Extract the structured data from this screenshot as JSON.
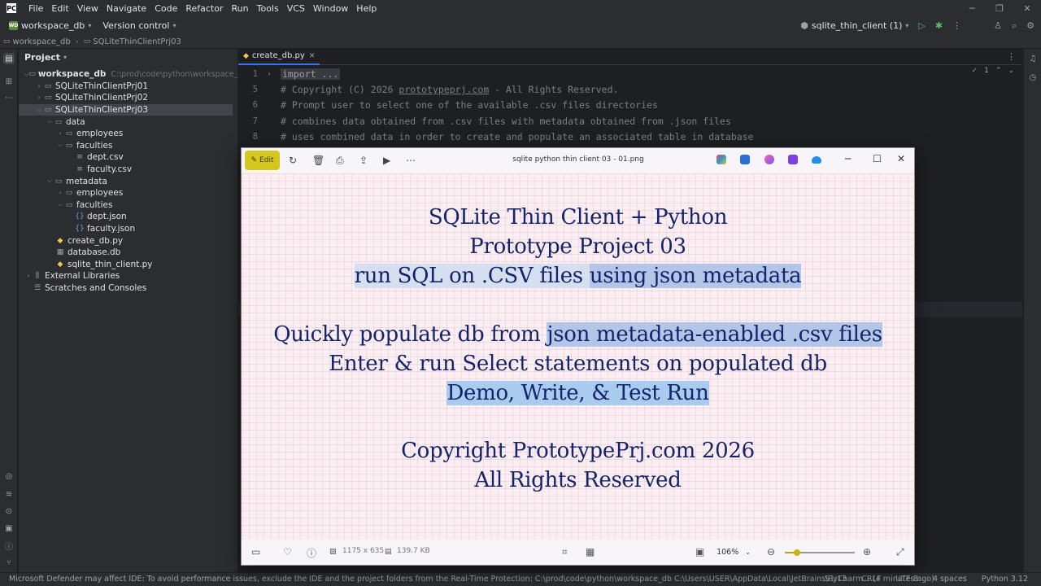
{
  "menu": [
    "File",
    "Edit",
    "View",
    "Navigate",
    "Code",
    "Refactor",
    "Run",
    "Tools",
    "VCS",
    "Window",
    "Help"
  ],
  "toolbar": {
    "project_badge": "WD",
    "project_name": "workspace_db",
    "vcs_label": "Version control",
    "run_config": "sqlite_thin_client (1)"
  },
  "breadcrumb": [
    "workspace_db",
    "SQLiteThinClientPrj03"
  ],
  "project_panel": {
    "title": "Project",
    "root_name": "workspace_db",
    "root_path": "C:\\prod\\code\\python\\workspace_db",
    "items": [
      "SQLiteThinClientPrj01",
      "SQLiteThinClientPrj02",
      "SQLiteThinClientPrj03",
      "data",
      "employees",
      "faculties",
      "dept.csv",
      "faculty.csv",
      "metadata",
      "employees",
      "faculties",
      "dept.json",
      "faculty.json",
      "create_db.py",
      "database.db",
      "sqlite_thin_client.py",
      "External Libraries",
      "Scratches and Consoles"
    ]
  },
  "editor": {
    "tab_label": "create_db.py",
    "inspection_count": "1",
    "lines": [
      {
        "num": "1",
        "text": "import ..."
      },
      {
        "num": "5",
        "text": "# Copyright (C) 2026 "
      },
      {
        "num": "6",
        "text": "# Prompt user to select one of the available .csv files directories"
      },
      {
        "num": "7",
        "text": "# combines data obtained from .csv files with metadata obtained from .json files"
      },
      {
        "num": "8",
        "text": "# uses combined data in order to create and populate an associated table in database"
      }
    ],
    "copyright_site": "prototypeprj.com",
    "copyright_tail": " - All Rights Reserved."
  },
  "viewer": {
    "edit_label": "Edit",
    "filename": "sqlite python thin client 03 - 01.png",
    "dimensions": "1175 x 635",
    "file_size": "139.7 KB",
    "zoom": "106%",
    "zoom_fraction": 0.18,
    "slide": {
      "line1": "SQLite Thin Client + Python",
      "line2": "Prototype Project 03",
      "line3a": "run SQL on .CSV files ",
      "line3b": "using json metadata",
      "line4a": "Quickly populate db from ",
      "line4b": "json metadata-enabled .csv files",
      "line5": "Enter & run Select statements on populated db",
      "line6": "Demo, Write, & Test Run",
      "line7": "Copyright PrototypePrj.com 2026",
      "line8": "All Rights Reserved"
    }
  },
  "status": {
    "message": "Microsoft Defender may affect IDE: To avoid performance issues, exclude the IDE and the project folders from the Real-Time Protection: C:\\prod\\code\\python\\workspace_db C:\\Users\\USER\\AppData\\Local\\JetBrains\\PyCharm... (4 minutes ago)",
    "position": "51:13",
    "line_sep": "CRLF",
    "encoding": "UTF-8",
    "indent": "4 spaces",
    "interpreter": "Python 3.12"
  }
}
